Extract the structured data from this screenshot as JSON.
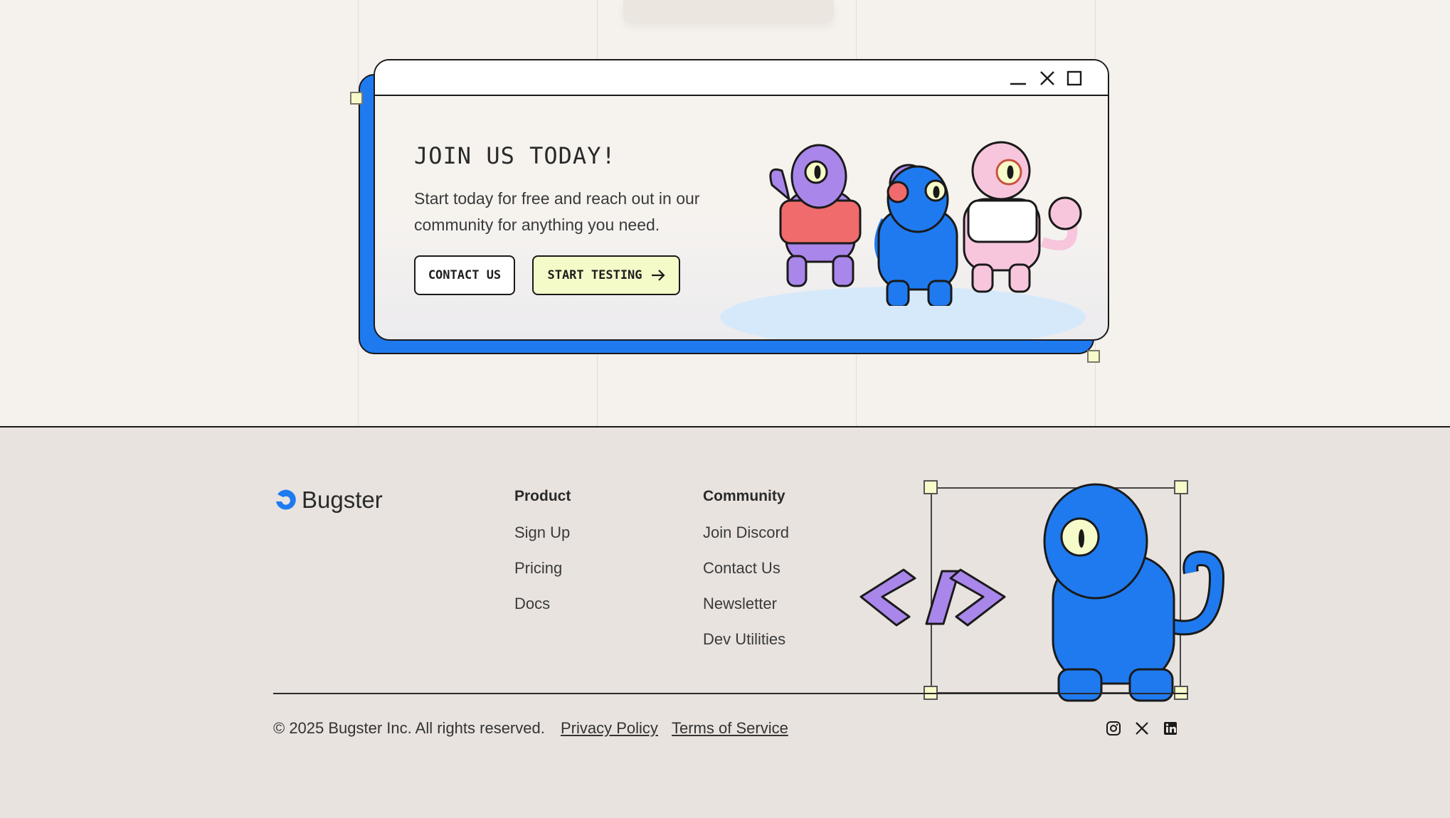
{
  "cta": {
    "title": "JOIN US TODAY!",
    "description": "Start today for free and reach out in our community for anything you need.",
    "contact_label": "CONTACT US",
    "start_label": "START TESTING"
  },
  "footer": {
    "brand": "Bugster",
    "columns": [
      {
        "heading": "Product",
        "links": [
          "Sign Up",
          "Pricing",
          "Docs"
        ]
      },
      {
        "heading": "Community",
        "links": [
          "Join Discord",
          "Contact Us",
          "Newsletter",
          "Dev Utilities"
        ]
      }
    ],
    "copyright": "© 2025 Bugster Inc. All rights reserved.",
    "privacy": "Privacy Policy",
    "terms": "Terms of Service",
    "social_icons": [
      "instagram-icon",
      "x-icon",
      "linkedin-icon"
    ]
  },
  "colors": {
    "accent_blue": "#1f7af0",
    "button_highlight": "#f4fbc8",
    "background": "#f5f1ec",
    "footer_background": "#e8e3df"
  }
}
